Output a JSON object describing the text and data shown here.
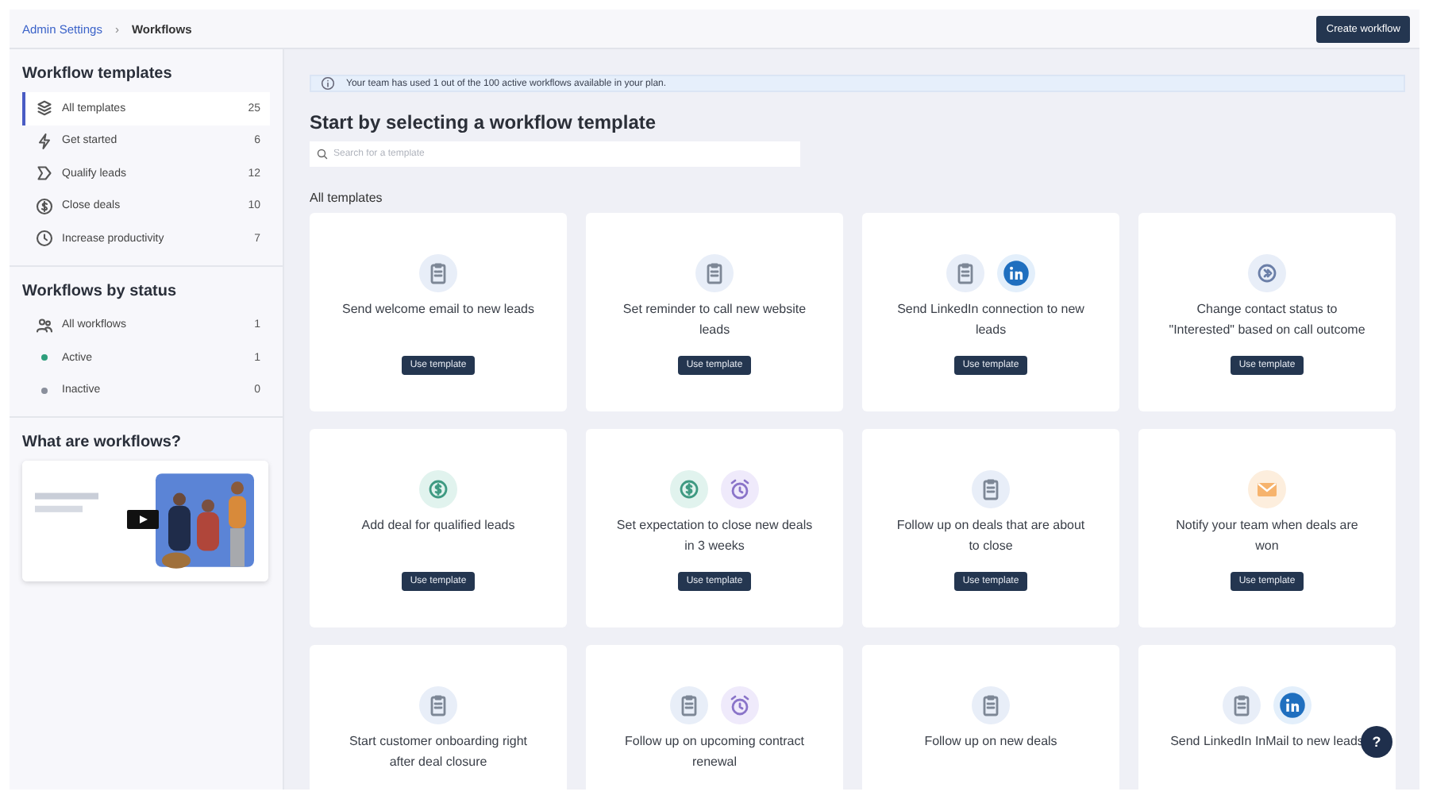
{
  "breadcrumb": {
    "parent": "Admin Settings",
    "separator": "›",
    "current": "Workflows"
  },
  "primary_button": "Create workflow",
  "sidebar": {
    "sections": [
      {
        "title": "Workflow templates",
        "items": [
          {
            "kind": "stack",
            "label": "All templates",
            "count": "25",
            "selected": true
          },
          {
            "kind": "bolt",
            "label": "Get started",
            "count": "6",
            "selected": false
          },
          {
            "kind": "tag",
            "label": "Qualify leads",
            "count": "12",
            "selected": false
          },
          {
            "kind": "dollar",
            "label": "Close deals",
            "count": "10",
            "selected": false
          },
          {
            "kind": "clock",
            "label": "Increase productivity",
            "count": "7",
            "selected": false
          }
        ]
      },
      {
        "title": "Workflows by status",
        "items": [
          {
            "kind": "people",
            "label": "All workflows",
            "count": "1",
            "selected": false
          },
          {
            "kind": "dot",
            "color": "#2e9e7c",
            "label": "Active",
            "count": "1",
            "selected": false
          },
          {
            "kind": "dot",
            "color": "#8a8f9c",
            "label": "Inactive",
            "count": "0",
            "selected": false
          }
        ]
      }
    ],
    "video": {
      "title": "What are workflows?"
    }
  },
  "notice": "Your team has used 1 out of the 100 active workflows available in your plan.",
  "heading": "Start by selecting a workflow template",
  "search": {
    "placeholder": "Search for a template"
  },
  "section_title": "All templates",
  "templates": [
    {
      "icons": [
        {
          "kind": "clipboard"
        }
      ],
      "title": "Send welcome email to new leads",
      "button": "Use template"
    },
    {
      "icons": [
        {
          "kind": "clipboard"
        }
      ],
      "title": "Set reminder to call new website leads",
      "button": "Use template"
    },
    {
      "icons": [
        {
          "kind": "clipboard"
        },
        {
          "kind": "linkedin"
        }
      ],
      "title": "Send LinkedIn connection to new leads",
      "button": "Use template"
    },
    {
      "icons": [
        {
          "kind": "status"
        }
      ],
      "title": "Change contact status to \"Interested\" based on call outcome",
      "button": "Use template"
    },
    {
      "icons": [
        {
          "kind": "dollar"
        }
      ],
      "title": "Add deal for qualified leads",
      "button": "Use template"
    },
    {
      "icons": [
        {
          "kind": "dollar"
        },
        {
          "kind": "alarm"
        }
      ],
      "title": "Set expectation to close new deals in 3 weeks",
      "button": "Use template"
    },
    {
      "icons": [
        {
          "kind": "clipboard"
        }
      ],
      "title": "Follow up on deals that are about to close",
      "button": "Use template"
    },
    {
      "icons": [
        {
          "kind": "mail"
        }
      ],
      "title": "Notify your team when deals are won",
      "button": "Use template"
    },
    {
      "icons": [
        {
          "kind": "clipboard"
        }
      ],
      "title": "Start customer onboarding right after deal closure"
    },
    {
      "icons": [
        {
          "kind": "clipboard"
        },
        {
          "kind": "alarm"
        }
      ],
      "title": "Follow up on upcoming contract renewal"
    },
    {
      "icons": [
        {
          "kind": "clipboard"
        }
      ],
      "title": "Follow up on new deals"
    },
    {
      "icons": [
        {
          "kind": "clipboard"
        },
        {
          "kind": "linkedin"
        }
      ],
      "title": "Send LinkedIn InMail to new leads"
    }
  ],
  "help_button": "?"
}
